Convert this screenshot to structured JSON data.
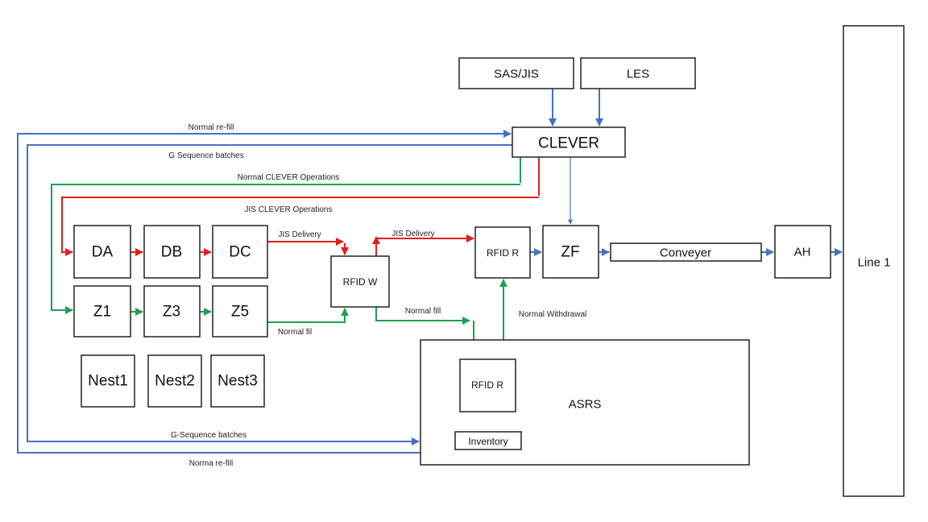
{
  "nodes": {
    "sas_jis": "SAS/JIS",
    "les": "LES",
    "clever": "CLEVER",
    "da": "DA",
    "db": "DB",
    "dc": "DC",
    "z1": "Z1",
    "z3": "Z3",
    "z5": "Z5",
    "nest1": "Nest1",
    "nest2": "Nest2",
    "nest3": "Nest3",
    "rfid_w": "RFID W",
    "rfid_r": "RFID R",
    "zf": "ZF",
    "conveyer": "Conveyer",
    "ah": "AH",
    "line1": "Line 1",
    "asrs": "ASRS",
    "rfid_r_inner": "RFID R",
    "inventory": "Inventory"
  },
  "edges": {
    "normal_refill_top": "Normal re-fill",
    "g_sequence_top": "G Sequence batches",
    "normal_clever_ops": "Normal CLEVER Operations",
    "jis_clever_ops": "JIS CLEVER Operations",
    "jis_delivery_1": "JIS Delivery",
    "jis_delivery_2": "JIS Delivery",
    "normal_fill_1": "Normal fill",
    "normal_fill_2": "Normal fil",
    "normal_withdrawal": "Normal Withdrawal",
    "g_sequence_bottom": "G-Sequence batches",
    "normal_refill_bottom": "Norma re-fill"
  },
  "colors": {
    "normal": "#1fa055",
    "jis": "#e02020",
    "info": "#4472c4"
  }
}
